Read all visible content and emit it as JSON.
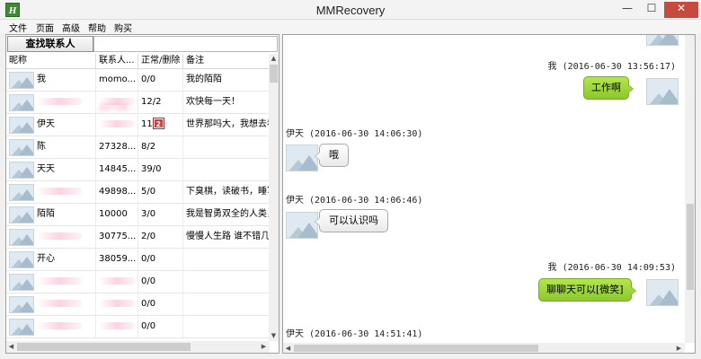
{
  "window": {
    "title": "MMRecovery",
    "app_icon_letter": "H"
  },
  "menu": [
    "文件",
    "页面",
    "高级",
    "帮助",
    "购买"
  ],
  "contacts_panel": {
    "find_button_label": "查找联系人",
    "search_value": "",
    "columns": [
      "昵称",
      "联系人...",
      "正常/删除",
      "备注"
    ],
    "rows": [
      {
        "nickname": "我",
        "contact": "momo...",
        "counts": "0/0",
        "note": "我的陌陌"
      },
      {
        "nickname": "",
        "contact": "20726...",
        "counts": "12/2",
        "note": "欢快每一天！"
      },
      {
        "nickname": "伊天",
        "contact": "",
        "counts": "11",
        "badge": "2",
        "note": "世界那吗大，我想去看"
      },
      {
        "nickname": "陈",
        "contact": "27328...",
        "counts": "8/2",
        "note": ""
      },
      {
        "nickname": "天天",
        "contact": "14845...",
        "counts": "39/0",
        "note": ""
      },
      {
        "nickname": "",
        "contact": "49898...",
        "counts": "5/0",
        "note": "下臭棋，读破书，睡写"
      },
      {
        "nickname": "陌陌",
        "contact": "10000",
        "counts": "3/0",
        "note": "我是智勇双全的人类，"
      },
      {
        "nickname": "",
        "contact": "30775...",
        "counts": "2/0",
        "note": "慢慢人生路 谁不错几步"
      },
      {
        "nickname": "开心",
        "contact": "38059...",
        "counts": "0/0",
        "note": ""
      },
      {
        "nickname": "",
        "contact": "",
        "counts": "0/0",
        "note": ""
      },
      {
        "nickname": "",
        "contact": "",
        "counts": "0/0",
        "note": ""
      },
      {
        "nickname": "",
        "contact": "",
        "counts": "0/0",
        "note": ""
      }
    ],
    "blurred": [
      {
        "nickname": false,
        "contact": false
      },
      {
        "nickname": true,
        "contact": true
      },
      {
        "nickname": false,
        "contact": true
      },
      {
        "nickname": false,
        "contact": false
      },
      {
        "nickname": false,
        "contact": false
      },
      {
        "nickname": true,
        "contact": false
      },
      {
        "nickname": false,
        "contact": false
      },
      {
        "nickname": true,
        "contact": false
      },
      {
        "nickname": false,
        "contact": false
      },
      {
        "nickname": true,
        "contact": true
      },
      {
        "nickname": true,
        "contact": true
      },
      {
        "nickname": true,
        "contact": true
      }
    ]
  },
  "chat": {
    "messages": [
      {
        "side": "right",
        "meta": "我 (2016-06-30 13:56:17)",
        "text": "工作啊"
      },
      {
        "side": "left",
        "meta": "伊天 (2016-06-30 14:06:30)",
        "text": "哦"
      },
      {
        "side": "left",
        "meta": "伊天 (2016-06-30 14:06:46)",
        "text": "可以认识吗"
      },
      {
        "side": "right",
        "meta": "我 (2016-06-30 14:09:53)",
        "text": "聊聊天可以[微笑]"
      },
      {
        "side": "left",
        "meta": "伊天 (2016-06-30 14:51:41)",
        "text": ""
      }
    ]
  }
}
